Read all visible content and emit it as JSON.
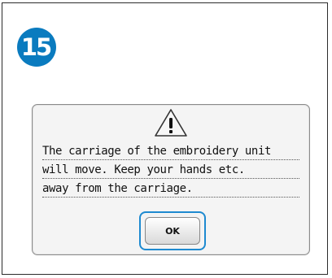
{
  "step": {
    "number": "15",
    "color": "#0a7bbf"
  },
  "dialog": {
    "icon": "warning-icon",
    "message_lines": [
      "The carriage of the embroidery unit",
      "will move. Keep your hands etc.",
      "away from the carriage."
    ],
    "ok_label": "OK",
    "focus_color": "#1e8ad0"
  }
}
